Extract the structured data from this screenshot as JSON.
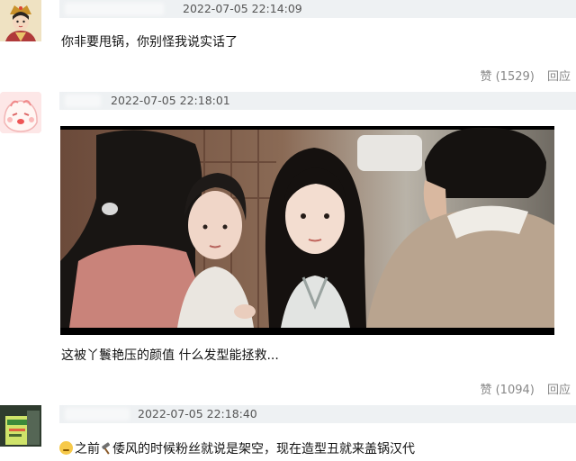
{
  "comments": [
    {
      "timestamp": "2022-07-05 22:14:09",
      "text": "你非要甩锅，你别怪我说实话了",
      "like_label": "赞",
      "like_count": "(1529)",
      "reply_label": "回应"
    },
    {
      "timestamp": "2022-07-05 22:18:01",
      "text": "这被丫鬟艳压的颜值 什么发型能拯救...",
      "like_label": "赞",
      "like_count": "(1094)",
      "reply_label": "回应"
    },
    {
      "timestamp": "2022-07-05 22:18:40",
      "text_part1": "之前",
      "text_part2": "倭风的时候粉丝就说是架空，现在造型丑就来盖锅汉代",
      "emoji_icon": "weary-face-emoji",
      "tool_icon": "hammer-icon"
    }
  ],
  "colors": {
    "meta_bar": "#eef1f3",
    "action_text": "#888888"
  }
}
